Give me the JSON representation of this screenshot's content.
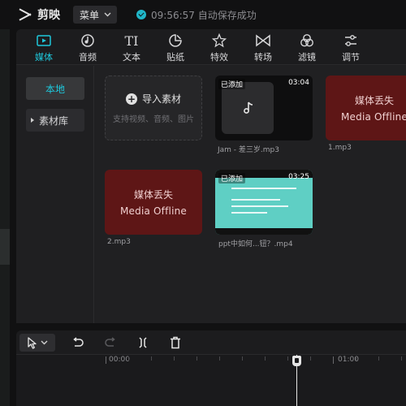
{
  "app": {
    "name": "剪映"
  },
  "topbar": {
    "menu_label": "菜单",
    "save_status": "09:56:57 自动保存成功"
  },
  "tools": [
    {
      "label": "媒体",
      "icon": "media-icon",
      "active": true
    },
    {
      "label": "音频",
      "icon": "audio-icon"
    },
    {
      "label": "文本",
      "icon": "text-icon"
    },
    {
      "label": "贴纸",
      "icon": "sticker-icon"
    },
    {
      "label": "特效",
      "icon": "effects-icon"
    },
    {
      "label": "转场",
      "icon": "transition-icon"
    },
    {
      "label": "滤镜",
      "icon": "filter-icon"
    },
    {
      "label": "调节",
      "icon": "adjust-icon"
    }
  ],
  "sidebar": {
    "local": "本地",
    "library": "素材库"
  },
  "import": {
    "label": "导入素材",
    "hint": "支持视频、音频、图片"
  },
  "media": [
    {
      "kind": "audio",
      "badge": "已添加",
      "duration": "03:04",
      "caption": "Jam - 差三岁.mp3"
    },
    {
      "kind": "offline",
      "line1": "媒体丢失",
      "line2": "Media Offline",
      "caption": "1.mp3"
    },
    {
      "kind": "offline",
      "line1": "媒体丢失",
      "line2": "Media Offline",
      "caption": "2.mp3"
    },
    {
      "kind": "video",
      "badge": "已添加",
      "duration": "03:25",
      "caption": "ppt中如何...钮？.mp4"
    }
  ],
  "timeline": {
    "label_start": "00:00",
    "label_end": "01:00"
  },
  "colors": {
    "accent": "#1ec8dc",
    "offline": "#5e1616",
    "teal_thumb": "#5fcfc4"
  }
}
